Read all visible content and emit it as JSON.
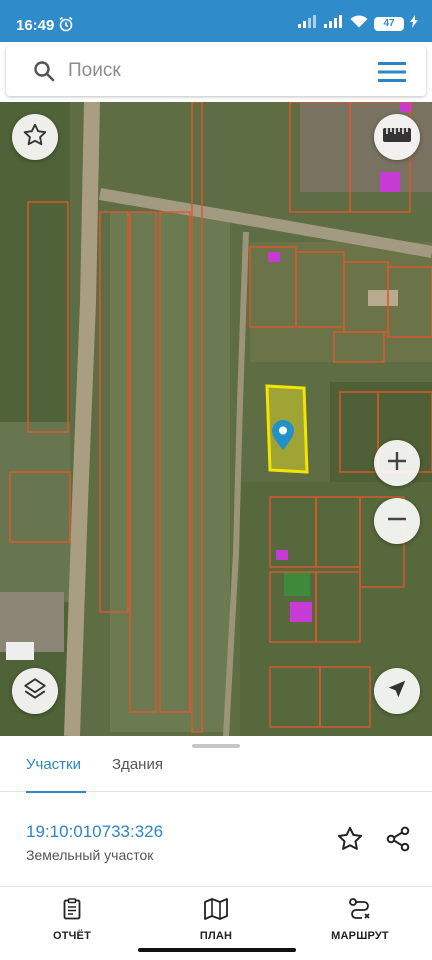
{
  "status_bar": {
    "time": "16:49",
    "battery": "47"
  },
  "search": {
    "placeholder": "Поиск",
    "value": ""
  },
  "tabs": [
    {
      "label": "Участки",
      "active": true
    },
    {
      "label": "Здания",
      "active": false
    }
  ],
  "parcel": {
    "number": "19:10:010733:326",
    "type": "Земельный участок"
  },
  "bottom_nav": [
    {
      "label": "ОТЧЁТ",
      "icon": "report-icon"
    },
    {
      "label": "ПЛАН",
      "icon": "map-plan-icon"
    },
    {
      "label": "МАРШРУТ",
      "icon": "route-icon"
    }
  ],
  "colors": {
    "accent": "#2f86c4",
    "status_bar": "#2f8bc9",
    "parcel_border": "#e0572b",
    "selected_parcel": "#f2e500"
  }
}
